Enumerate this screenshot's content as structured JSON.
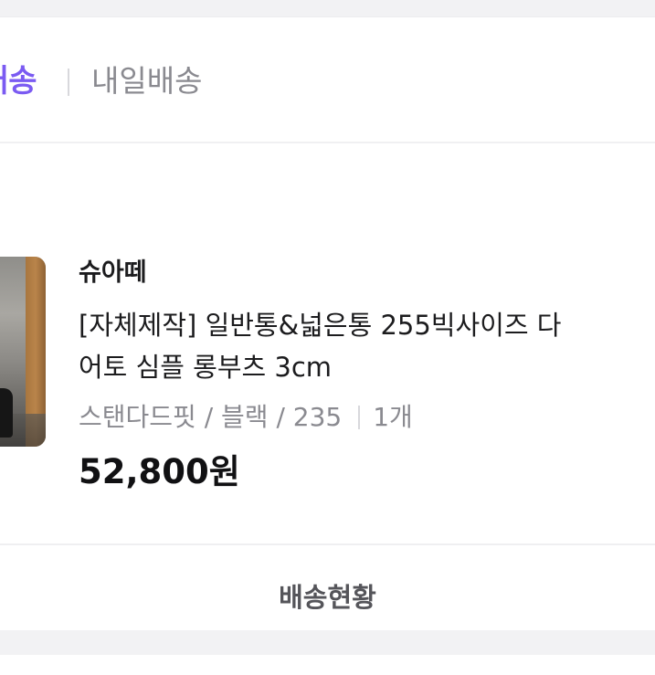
{
  "delivery_tabs": {
    "active_label": "배송",
    "inactive_label": "내일배송"
  },
  "product": {
    "seller": "슈아떼",
    "name_line1": "[자체제작] 일반통&넓은통 255빅사이즈 다",
    "name_line2": "어토 심플 롱부츠 3cm",
    "options": "스탠다드핏 / 블랙 / 235",
    "quantity": "1개",
    "price": "52,800원"
  },
  "actions": {
    "status_label": "배송현황"
  },
  "colors": {
    "accent": "#7b5bf2",
    "text_primary": "#1c1c1e",
    "text_secondary": "#8a8a90",
    "background": "#f2f2f4"
  }
}
